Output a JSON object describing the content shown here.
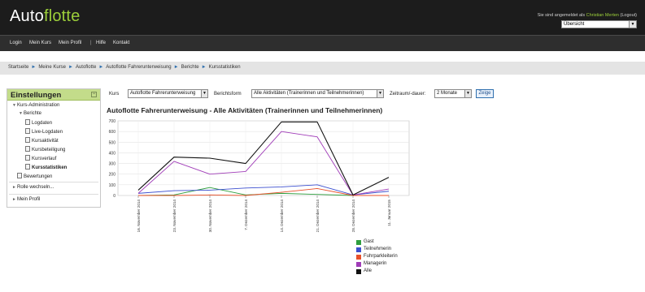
{
  "header": {
    "logo_part1": "Auto",
    "logo_part2": "flotte",
    "login_prefix": "Sie sind angemeldet als ",
    "login_user": "Christian Merten",
    "login_logout": " (Logout)",
    "view_select_value": "Übersicht"
  },
  "nav": {
    "items": [
      "Login",
      "Mein Kurs",
      "Mein Profil",
      "Hilfe",
      "Kontakt"
    ],
    "divider": "|"
  },
  "breadcrumb": {
    "items": [
      "Startseite",
      "Meine Kurse",
      "Autoflotte",
      "Autoflotte Fahrerunterweisung",
      "Berichte",
      "Kursstatistiken"
    ],
    "separator": "►"
  },
  "settings": {
    "title": "Einstellungen",
    "toggle": "−",
    "kurs_admin": "Kurs-Administration",
    "berichte": "Berichte",
    "reports": [
      "Logdaten",
      "Live-Logdaten",
      "Kursaktivität",
      "Kursbeteiligung",
      "Kursverlauf",
      "Kursstatistiken"
    ],
    "bewertungen": "Bewertungen",
    "rolle": "Rolle wechseln...",
    "profil": "Mein Profil"
  },
  "controls": {
    "kurs_label": "Kurs",
    "kurs_value": "Autoflotte Fahrerunterweisung",
    "berichtsform_label": "Berichtsform",
    "berichtsform_value": "Alle Aktivitäten (Trainerinnen und Teilnehmerinnen)",
    "zeitraum_label": "Zeitraum/-dauer:",
    "zeitraum_value": "2 Monate",
    "go_label": "Zeige"
  },
  "colors": {
    "brand_green": "#9ccf3a",
    "header_bg": "#1c1c1c",
    "settings_header_bg": "#c3dc8a",
    "link_blue": "#2f6fae"
  },
  "chart_data": {
    "type": "line",
    "title": "Autoflotte Fahrerunterweisung - Alle Aktivitäten (Trainerinnen und Teilnehmerinnen)",
    "x": [
      "16. November 2014",
      "23. November 2014",
      "30. November 2014",
      "7. Dezember 2014",
      "14. Dezember 2014",
      "21. Dezember 2014",
      "28. Dezember 2014",
      "11. Januar 2015"
    ],
    "y_ticks": [
      0,
      100,
      200,
      300,
      400,
      500,
      600,
      700
    ],
    "ylim": [
      0,
      700
    ],
    "grid": true,
    "legend_position": "bottom",
    "series": [
      {
        "name": "Gast",
        "color": "#2e9e3e",
        "values": [
          0,
          5,
          75,
          5,
          20,
          10,
          0,
          0
        ]
      },
      {
        "name": "Teilnehmerin",
        "color": "#3c4fcf",
        "values": [
          20,
          45,
          50,
          70,
          80,
          100,
          5,
          40
        ]
      },
      {
        "name": "Fuhrparkleiterin",
        "color": "#e8502a",
        "values": [
          0,
          0,
          5,
          0,
          30,
          65,
          0,
          0
        ]
      },
      {
        "name": "Managerin",
        "color": "#a03cb8",
        "values": [
          20,
          320,
          200,
          225,
          600,
          550,
          5,
          60
        ]
      },
      {
        "name": "Alle",
        "color": "#111111",
        "values": [
          50,
          360,
          350,
          300,
          690,
          690,
          5,
          170
        ]
      }
    ]
  }
}
